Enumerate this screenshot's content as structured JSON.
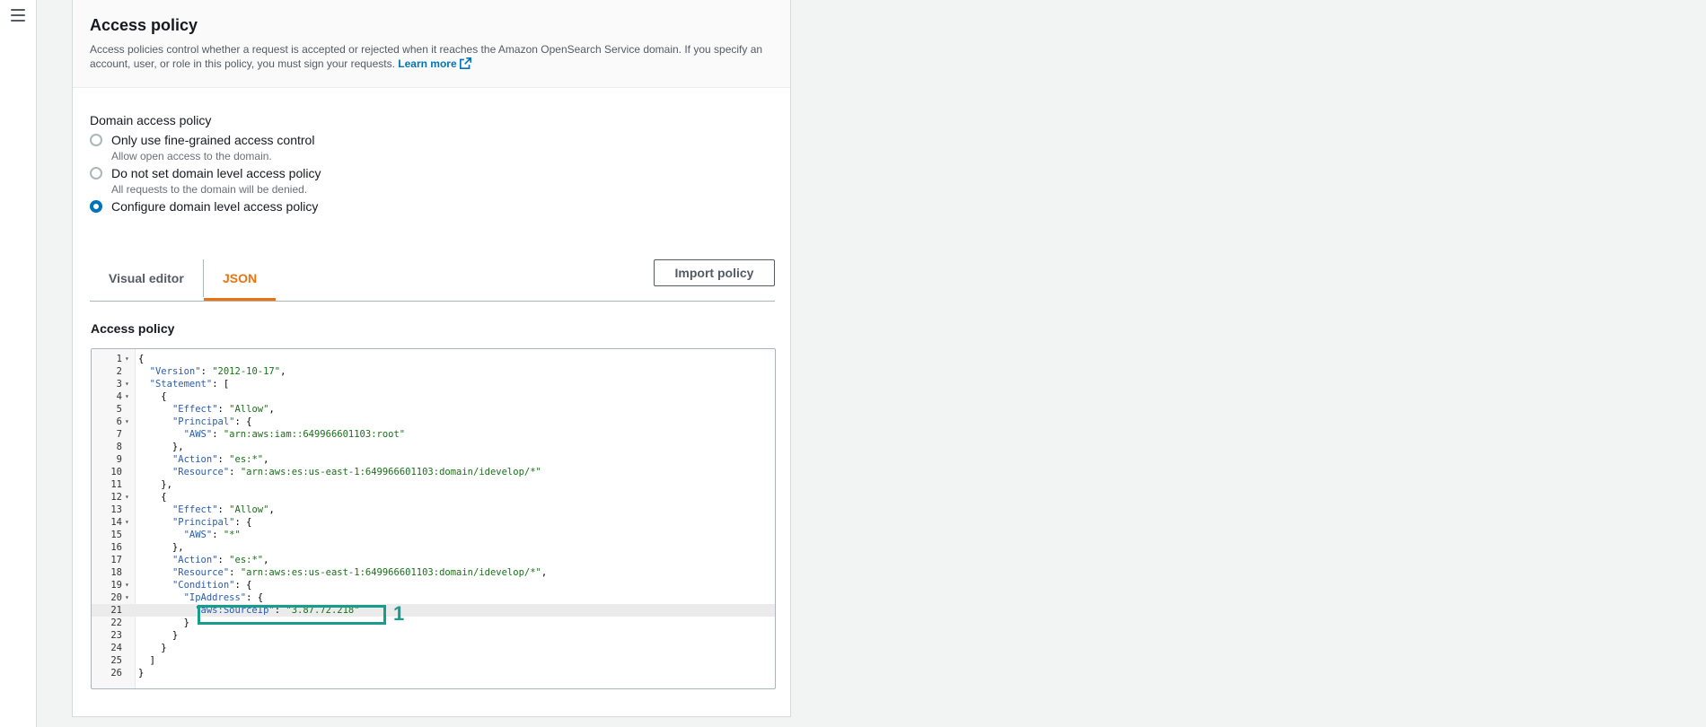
{
  "panel": {
    "title": "Access policy",
    "description": "Access policies control whether a request is accepted or rejected when it reaches the Amazon OpenSearch Service domain. If you specify an account, user, or role in this policy, you must sign your requests.",
    "learn_more": "Learn more"
  },
  "domain_access": {
    "label": "Domain access policy",
    "options": [
      {
        "label": "Only use fine-grained access control",
        "description": "Allow open access to the domain.",
        "selected": false
      },
      {
        "label": "Do not set domain level access policy",
        "description": "All requests to the domain will be denied.",
        "selected": false
      },
      {
        "label": "Configure domain level access policy",
        "description": "",
        "selected": true
      }
    ]
  },
  "tabs": [
    {
      "label": "Visual editor",
      "active": false
    },
    {
      "label": "JSON",
      "active": true
    }
  ],
  "import_button": "Import policy",
  "editor": {
    "label": "Access policy",
    "highlighted_line": 21,
    "lines": [
      {
        "n": "1",
        "fold": true,
        "text": "{"
      },
      {
        "n": "2",
        "fold": false,
        "text": "  \"Version\": \"2012-10-17\","
      },
      {
        "n": "3",
        "fold": true,
        "text": "  \"Statement\": ["
      },
      {
        "n": "4",
        "fold": true,
        "text": "    {"
      },
      {
        "n": "5",
        "fold": false,
        "text": "      \"Effect\": \"Allow\","
      },
      {
        "n": "6",
        "fold": true,
        "text": "      \"Principal\": {"
      },
      {
        "n": "7",
        "fold": false,
        "text": "        \"AWS\": \"arn:aws:iam::649966601103:root\""
      },
      {
        "n": "8",
        "fold": false,
        "text": "      },"
      },
      {
        "n": "9",
        "fold": false,
        "text": "      \"Action\": \"es:*\","
      },
      {
        "n": "10",
        "fold": false,
        "text": "      \"Resource\": \"arn:aws:es:us-east-1:649966601103:domain/idevelop/*\""
      },
      {
        "n": "11",
        "fold": false,
        "text": "    },"
      },
      {
        "n": "12",
        "fold": true,
        "text": "    {"
      },
      {
        "n": "13",
        "fold": false,
        "text": "      \"Effect\": \"Allow\","
      },
      {
        "n": "14",
        "fold": true,
        "text": "      \"Principal\": {"
      },
      {
        "n": "15",
        "fold": false,
        "text": "        \"AWS\": \"*\""
      },
      {
        "n": "16",
        "fold": false,
        "text": "      },"
      },
      {
        "n": "17",
        "fold": false,
        "text": "      \"Action\": \"es:*\","
      },
      {
        "n": "18",
        "fold": false,
        "text": "      \"Resource\": \"arn:aws:es:us-east-1:649966601103:domain/idevelop/*\","
      },
      {
        "n": "19",
        "fold": true,
        "text": "      \"Condition\": {"
      },
      {
        "n": "20",
        "fold": true,
        "text": "        \"IpAddress\": {"
      },
      {
        "n": "21",
        "fold": false,
        "text": "          \"aws:SourceIp\": \"3.87.72.218\""
      },
      {
        "n": "22",
        "fold": false,
        "text": "        }"
      },
      {
        "n": "23",
        "fold": false,
        "text": "      }"
      },
      {
        "n": "24",
        "fold": false,
        "text": "    }"
      },
      {
        "n": "25",
        "fold": false,
        "text": "  ]"
      },
      {
        "n": "26",
        "fold": false,
        "text": "}"
      }
    ]
  },
  "callout": {
    "number": "1",
    "color": "#1a9c8c"
  },
  "colors": {
    "accent_tab": "#ec7211",
    "link": "#0073bb",
    "radio_selected": "#0073bb"
  }
}
